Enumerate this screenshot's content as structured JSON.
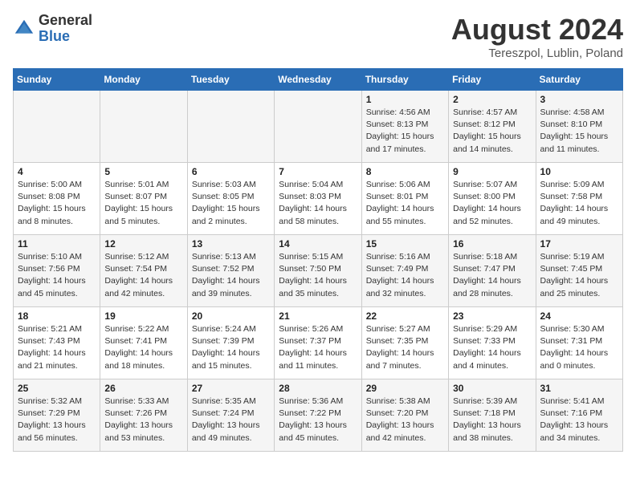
{
  "logo": {
    "general": "General",
    "blue": "Blue"
  },
  "title": "August 2024",
  "subtitle": "Tereszpol, Lublin, Poland",
  "headers": [
    "Sunday",
    "Monday",
    "Tuesday",
    "Wednesday",
    "Thursday",
    "Friday",
    "Saturday"
  ],
  "weeks": [
    [
      {
        "day": "",
        "info": ""
      },
      {
        "day": "",
        "info": ""
      },
      {
        "day": "",
        "info": ""
      },
      {
        "day": "",
        "info": ""
      },
      {
        "day": "1",
        "info": "Sunrise: 4:56 AM\nSunset: 8:13 PM\nDaylight: 15 hours and 17 minutes."
      },
      {
        "day": "2",
        "info": "Sunrise: 4:57 AM\nSunset: 8:12 PM\nDaylight: 15 hours and 14 minutes."
      },
      {
        "day": "3",
        "info": "Sunrise: 4:58 AM\nSunset: 8:10 PM\nDaylight: 15 hours and 11 minutes."
      }
    ],
    [
      {
        "day": "4",
        "info": "Sunrise: 5:00 AM\nSunset: 8:08 PM\nDaylight: 15 hours and 8 minutes."
      },
      {
        "day": "5",
        "info": "Sunrise: 5:01 AM\nSunset: 8:07 PM\nDaylight: 15 hours and 5 minutes."
      },
      {
        "day": "6",
        "info": "Sunrise: 5:03 AM\nSunset: 8:05 PM\nDaylight: 15 hours and 2 minutes."
      },
      {
        "day": "7",
        "info": "Sunrise: 5:04 AM\nSunset: 8:03 PM\nDaylight: 14 hours and 58 minutes."
      },
      {
        "day": "8",
        "info": "Sunrise: 5:06 AM\nSunset: 8:01 PM\nDaylight: 14 hours and 55 minutes."
      },
      {
        "day": "9",
        "info": "Sunrise: 5:07 AM\nSunset: 8:00 PM\nDaylight: 14 hours and 52 minutes."
      },
      {
        "day": "10",
        "info": "Sunrise: 5:09 AM\nSunset: 7:58 PM\nDaylight: 14 hours and 49 minutes."
      }
    ],
    [
      {
        "day": "11",
        "info": "Sunrise: 5:10 AM\nSunset: 7:56 PM\nDaylight: 14 hours and 45 minutes."
      },
      {
        "day": "12",
        "info": "Sunrise: 5:12 AM\nSunset: 7:54 PM\nDaylight: 14 hours and 42 minutes."
      },
      {
        "day": "13",
        "info": "Sunrise: 5:13 AM\nSunset: 7:52 PM\nDaylight: 14 hours and 39 minutes."
      },
      {
        "day": "14",
        "info": "Sunrise: 5:15 AM\nSunset: 7:50 PM\nDaylight: 14 hours and 35 minutes."
      },
      {
        "day": "15",
        "info": "Sunrise: 5:16 AM\nSunset: 7:49 PM\nDaylight: 14 hours and 32 minutes."
      },
      {
        "day": "16",
        "info": "Sunrise: 5:18 AM\nSunset: 7:47 PM\nDaylight: 14 hours and 28 minutes."
      },
      {
        "day": "17",
        "info": "Sunrise: 5:19 AM\nSunset: 7:45 PM\nDaylight: 14 hours and 25 minutes."
      }
    ],
    [
      {
        "day": "18",
        "info": "Sunrise: 5:21 AM\nSunset: 7:43 PM\nDaylight: 14 hours and 21 minutes."
      },
      {
        "day": "19",
        "info": "Sunrise: 5:22 AM\nSunset: 7:41 PM\nDaylight: 14 hours and 18 minutes."
      },
      {
        "day": "20",
        "info": "Sunrise: 5:24 AM\nSunset: 7:39 PM\nDaylight: 14 hours and 15 minutes."
      },
      {
        "day": "21",
        "info": "Sunrise: 5:26 AM\nSunset: 7:37 PM\nDaylight: 14 hours and 11 minutes."
      },
      {
        "day": "22",
        "info": "Sunrise: 5:27 AM\nSunset: 7:35 PM\nDaylight: 14 hours and 7 minutes."
      },
      {
        "day": "23",
        "info": "Sunrise: 5:29 AM\nSunset: 7:33 PM\nDaylight: 14 hours and 4 minutes."
      },
      {
        "day": "24",
        "info": "Sunrise: 5:30 AM\nSunset: 7:31 PM\nDaylight: 14 hours and 0 minutes."
      }
    ],
    [
      {
        "day": "25",
        "info": "Sunrise: 5:32 AM\nSunset: 7:29 PM\nDaylight: 13 hours and 56 minutes."
      },
      {
        "day": "26",
        "info": "Sunrise: 5:33 AM\nSunset: 7:26 PM\nDaylight: 13 hours and 53 minutes."
      },
      {
        "day": "27",
        "info": "Sunrise: 5:35 AM\nSunset: 7:24 PM\nDaylight: 13 hours and 49 minutes."
      },
      {
        "day": "28",
        "info": "Sunrise: 5:36 AM\nSunset: 7:22 PM\nDaylight: 13 hours and 45 minutes."
      },
      {
        "day": "29",
        "info": "Sunrise: 5:38 AM\nSunset: 7:20 PM\nDaylight: 13 hours and 42 minutes."
      },
      {
        "day": "30",
        "info": "Sunrise: 5:39 AM\nSunset: 7:18 PM\nDaylight: 13 hours and 38 minutes."
      },
      {
        "day": "31",
        "info": "Sunrise: 5:41 AM\nSunset: 7:16 PM\nDaylight: 13 hours and 34 minutes."
      }
    ]
  ]
}
